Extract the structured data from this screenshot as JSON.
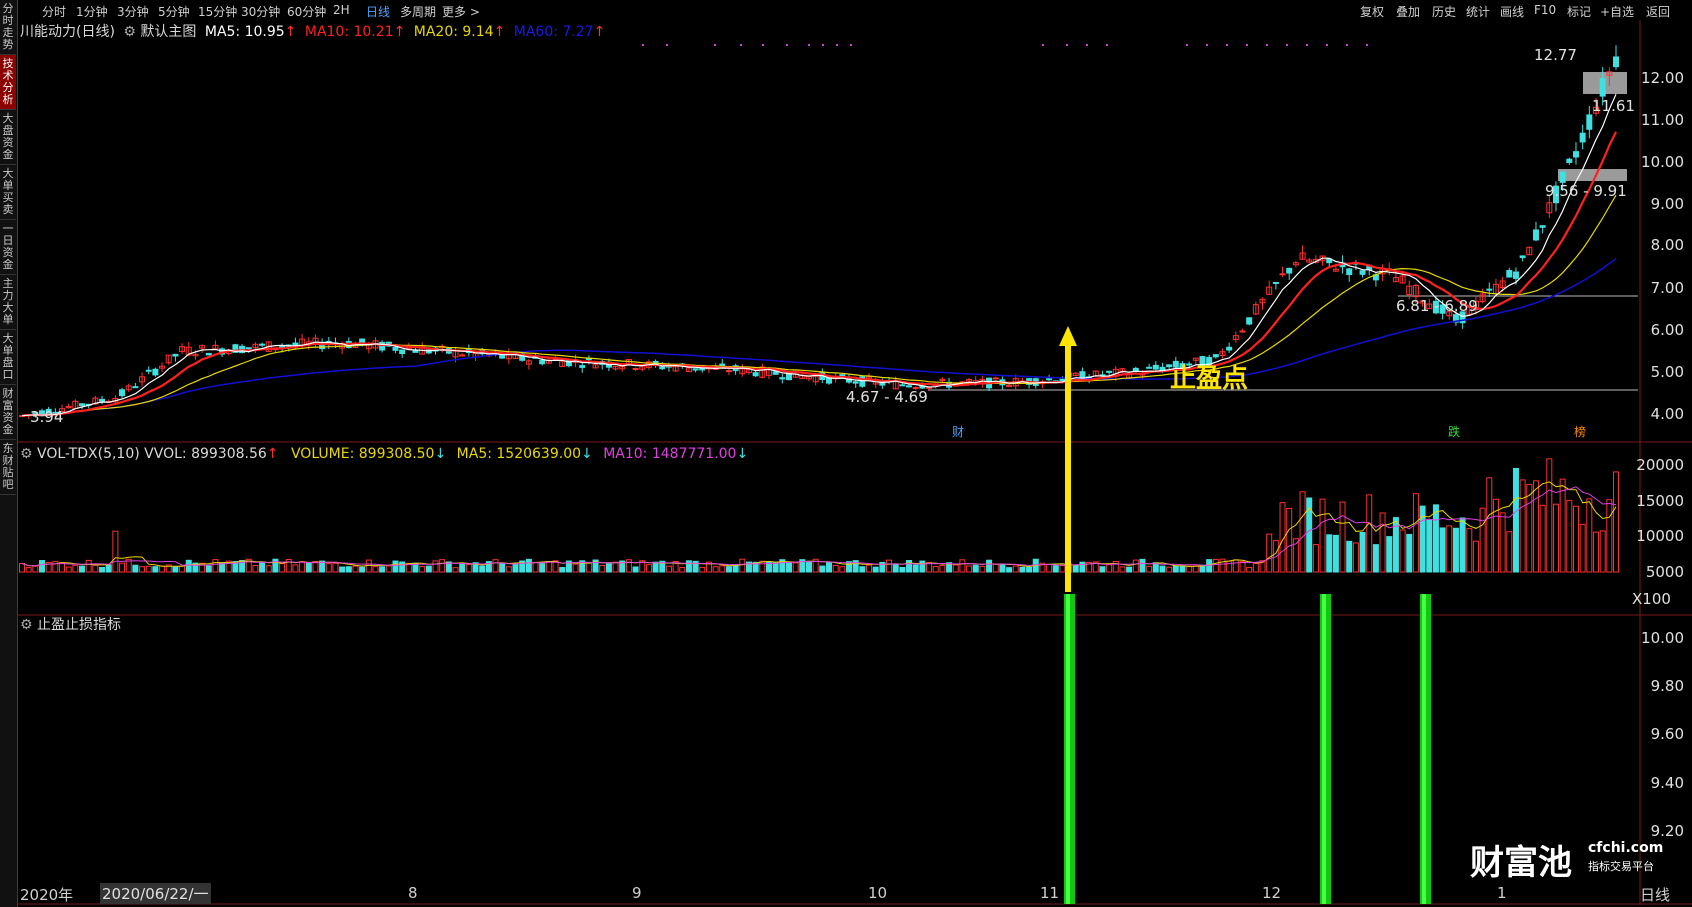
{
  "sidebar": {
    "tabs": [
      {
        "label": "分时走势",
        "active": false
      },
      {
        "label": "技术分析",
        "active": true
      },
      {
        "label": "大盘资金",
        "active": false
      },
      {
        "label": "大单买卖",
        "active": false
      },
      {
        "label": "一日资金",
        "active": false
      },
      {
        "label": "主力大单",
        "active": false
      },
      {
        "label": "大单盘口",
        "active": false
      },
      {
        "label": "财富资金",
        "active": false
      },
      {
        "label": "东财贴吧",
        "active": false
      }
    ]
  },
  "toolbar": {
    "periods": [
      "分时",
      "1分钟",
      "3分钟",
      "5分钟",
      "15分钟",
      "30分钟",
      "60分钟",
      "2H",
      "日线",
      "多周期",
      "更多 >"
    ],
    "active_period": "日线",
    "right_items": [
      "复权",
      "叠加",
      "历史",
      "统计",
      "画线",
      "F10",
      "标记",
      "+自选",
      "返回"
    ]
  },
  "main_chart": {
    "title": "川能动力(日线)",
    "template": "默认主图",
    "ma5": "MA5: 10.95",
    "ma10": "MA10: 10.21",
    "ma20": "MA20: 9.14",
    "ma60": "MA60: 7.27",
    "colors": {
      "ma5": "#ffffff",
      "ma10": "#ff2020",
      "ma20": "#e8d800",
      "ma60": "#1010d0",
      "up": "#ff3030",
      "down": "#40e0e0"
    },
    "price_axis": [
      "12.00",
      "11.00",
      "10.00",
      "9.00",
      "8.00",
      "7.00",
      "6.00",
      "5.00",
      "4.00"
    ],
    "annotations": {
      "high": "12.77",
      "price_label_1": "11.61",
      "range_1": "9.56 - 9.91",
      "range_2": "6.81 - 6.89",
      "range_3": "4.67 - 4.69",
      "low": "3.94",
      "take_profit": "止盈点"
    },
    "event_marks": [
      "财",
      "跌",
      "榜"
    ]
  },
  "volume_chart": {
    "title": "VOL-TDX(5,10)",
    "vvol": "VVOL: 899308.56",
    "volume": "VOLUME: 899308.50",
    "ma5": "MA5: 1520639.00",
    "ma10": "MA10: 1487771.00",
    "axis": [
      "20000",
      "15000",
      "10000",
      "5000"
    ],
    "unit": "X100"
  },
  "indicator_chart": {
    "title": "止盈止损指标",
    "axis": [
      "10.00",
      "9.80",
      "9.60",
      "9.40",
      "9.20"
    ]
  },
  "time_axis": {
    "year": "2020年",
    "cursor_date": "2020/06/22/一",
    "months": [
      "8",
      "9",
      "10",
      "11",
      "12",
      "1"
    ],
    "period_label": "日线"
  },
  "watermark": {
    "brand": "财富池",
    "domain": "cfchi.com",
    "subtitle": "指标交易平台"
  }
}
